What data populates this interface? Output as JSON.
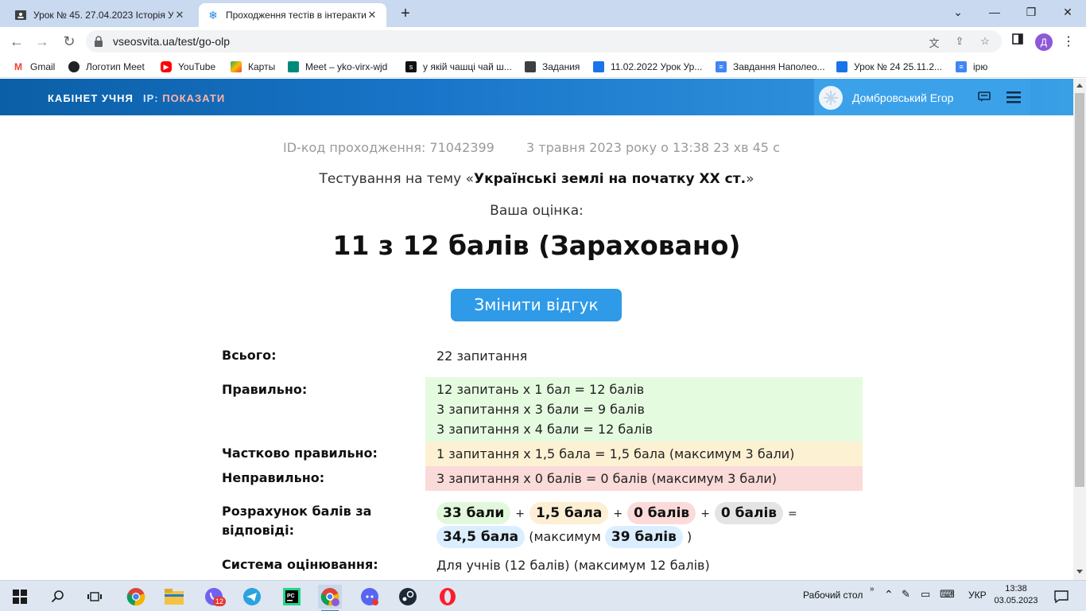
{
  "browser": {
    "tabs": [
      {
        "title": "Урок № 45. 27.04.2023 Історія У",
        "active": false,
        "icon": "classroom-icon"
      },
      {
        "title": "Проходження тестів в інтеракти",
        "active": true,
        "icon": "snowflake-icon"
      }
    ],
    "url": "vseosvita.ua/test/go-olp",
    "profile_initial": "Д",
    "bookmarks": [
      {
        "label": "Gmail",
        "icon": "gmail-icon"
      },
      {
        "label": "Логотип Meet",
        "icon": "globe-icon"
      },
      {
        "label": "YouTube",
        "icon": "youtube-icon"
      },
      {
        "label": "Карты",
        "icon": "maps-icon"
      },
      {
        "label": "Meet – yko-virx-wjd",
        "icon": "meet-icon"
      },
      {
        "label": "у якій чашці чай ш...",
        "icon": "slides-icon"
      },
      {
        "label": "Задания",
        "icon": "classroom-icon"
      },
      {
        "label": "11.02.2022 Урок Ур...",
        "icon": "classroom-icon"
      },
      {
        "label": "Завдання Наполео...",
        "icon": "docs-icon"
      },
      {
        "label": "Урок № 24 25.11.2...",
        "icon": "classroom-icon"
      },
      {
        "label": "ірю",
        "icon": "docs-icon"
      }
    ]
  },
  "site": {
    "cabinet_label": "КАБІНЕТ УЧНЯ",
    "ip_label": "IP:",
    "ip_action": "ПОКАЗАТИ",
    "user_name": "Домбровський Егор"
  },
  "result": {
    "id_line": "ID-код проходження: 71042399",
    "date_line": "3 травня 2023 року о 13:38 23 хв 45 с",
    "topic_prefix": "Тестування на тему «",
    "topic_name": "Українські землі на початку XX ст.",
    "topic_suffix": "»",
    "grade_label": "Ваша оцінка:",
    "grade": "11 з 12 балів (Зараховано)",
    "change_button": "Змінити відгук",
    "rows": {
      "total_label": "Всього:",
      "total_value": "22 запитання",
      "correct_label": "Правильно:",
      "correct_lines": [
        "12 запитань x 1 бал = 12 балів",
        "3 запитання x 3 бали = 9 балів",
        "3 запитання x 4 бали = 12 балів"
      ],
      "partial_label": "Частково правильно:",
      "partial_value": "1 запитання x 1,5 бала = 1,5 бала (максимум 3 бали)",
      "wrong_label": "Неправильно:",
      "wrong_value": "3 запитання x 0 балів = 0 балів (максимум 3 бали)",
      "calc_label": "Розрахунок балів за відповіді:",
      "calc": {
        "correct": "33 бали",
        "partial": "1,5 бала",
        "wrong": "0 балів",
        "skipped": "0 балів",
        "total": "34,5 бала",
        "max_prefix": "(максимум",
        "max": "39 балів",
        "max_suffix": ")",
        "plus": "+",
        "equals": "="
      },
      "system_label": "Система оцінювання:",
      "system_value": "Для учнів (12 балів) (максимум 12 балів)"
    }
  },
  "taskbar": {
    "desktop_label": "Рабочий стол",
    "lang": "УКР",
    "time": "13:38",
    "date": "03.05.2023",
    "viber_badge": "12"
  }
}
